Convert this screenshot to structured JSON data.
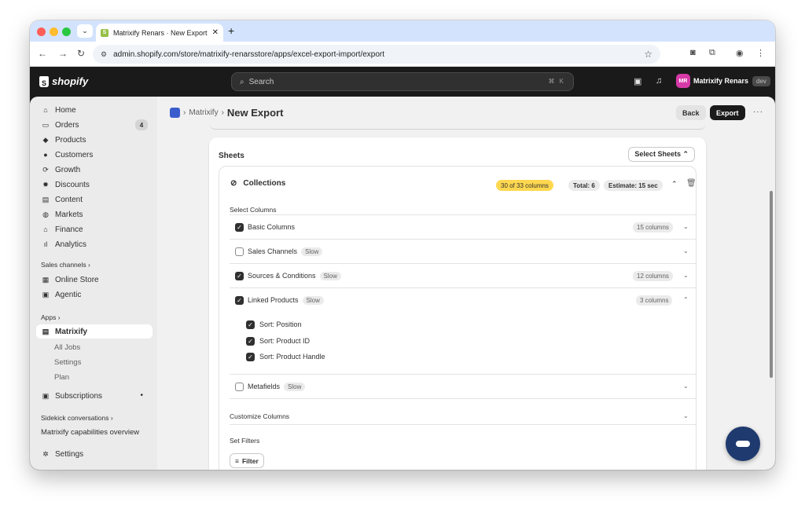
{
  "browser": {
    "tab_title": "Matrixify Renars · New Export",
    "tab_close": "✕",
    "new_tab": "+",
    "url_domain": "admin.shopify.com",
    "url_path": "/store/matrixify-renarsstore/apps/excel-export-import/export"
  },
  "shopify_bar": {
    "logo_text": "shopify",
    "search_placeholder": "Search",
    "search_shortcut": "⌘ K",
    "account_initials": "MR",
    "account_name": "Matrixify Renars",
    "account_badge": "dev"
  },
  "sidebar": {
    "items": [
      {
        "label": "Home",
        "icon": "home-icon"
      },
      {
        "label": "Orders",
        "icon": "orders-icon",
        "count": "4"
      },
      {
        "label": "Products",
        "icon": "tag-icon"
      },
      {
        "label": "Customers",
        "icon": "person-icon"
      },
      {
        "label": "Growth",
        "icon": "growth-icon"
      },
      {
        "label": "Discounts",
        "icon": "discount-icon"
      },
      {
        "label": "Content",
        "icon": "content-icon"
      },
      {
        "label": "Markets",
        "icon": "globe-icon"
      },
      {
        "label": "Finance",
        "icon": "bank-icon"
      },
      {
        "label": "Analytics",
        "icon": "chart-icon"
      }
    ],
    "sales_channels_label": "Sales channels ›",
    "online_store": "Online Store",
    "agentic": "Agentic",
    "apps_label": "Apps ›",
    "matrixify": "Matrixify",
    "matrixify_subs": [
      "All Jobs",
      "Settings",
      "Plan"
    ],
    "subscriptions": "Subscriptions",
    "sidekick_label": "Sidekick conversations ›",
    "sidekick_item": "Matrixify capabilities overview",
    "settings": "Settings"
  },
  "header": {
    "breadcrumb_app": "Matrixify",
    "breadcrumb_sep": "›",
    "title": "New Export",
    "back": "Back",
    "export": "Export",
    "more": "···"
  },
  "sheets": {
    "title": "Sheets",
    "select_sheets": "Select Sheets ⌃",
    "collection": {
      "name": "Collections",
      "columns_badge": "30 of 33 columns",
      "total": "Total: 6",
      "estimate": "Estimate: 15 sec"
    },
    "select_columns_label": "Select Columns",
    "groups": [
      {
        "label": "Basic Columns",
        "checked": true,
        "slow": "",
        "count": "15 columns"
      },
      {
        "label": "Sales Channels",
        "checked": false,
        "slow": "Slow",
        "count": ""
      },
      {
        "label": "Sources & Conditions",
        "checked": true,
        "slow": "Slow",
        "count": "12 columns"
      },
      {
        "label": "Linked Products",
        "checked": true,
        "slow": "Slow",
        "count": "3 columns"
      },
      {
        "label": "Metafields",
        "checked": false,
        "slow": "Slow",
        "count": ""
      }
    ],
    "linked_products_subs": [
      "Sort: Position",
      "Sort: Product ID",
      "Sort: Product Handle"
    ],
    "customize_columns": "Customize Columns",
    "set_filters": "Set Filters",
    "filter_button": "Filter"
  }
}
